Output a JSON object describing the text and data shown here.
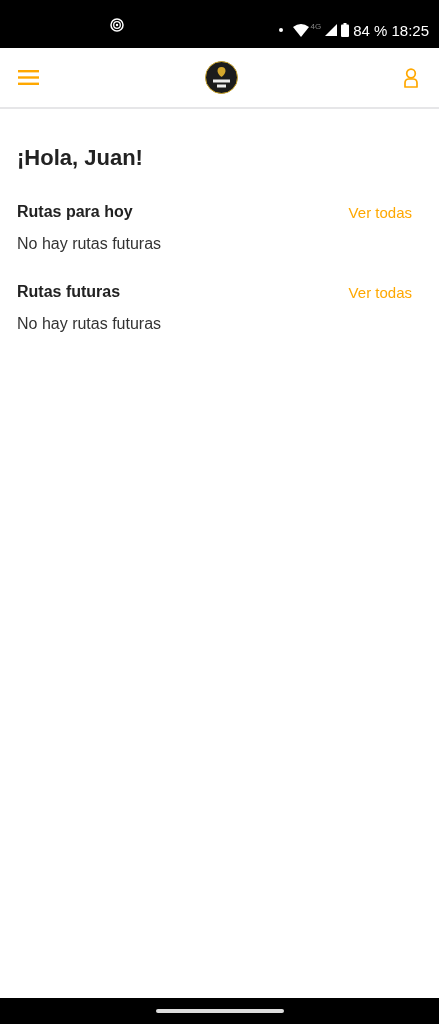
{
  "status_bar": {
    "network": "4G",
    "battery": "84 %",
    "time": "18:25"
  },
  "greeting": "¡Hola, Juan!",
  "sections": [
    {
      "title": "Rutas para hoy",
      "link": "Ver todas",
      "empty_text": "No hay rutas futuras"
    },
    {
      "title": "Rutas futuras",
      "link": "Ver todas",
      "empty_text": "No hay rutas futuras"
    }
  ]
}
